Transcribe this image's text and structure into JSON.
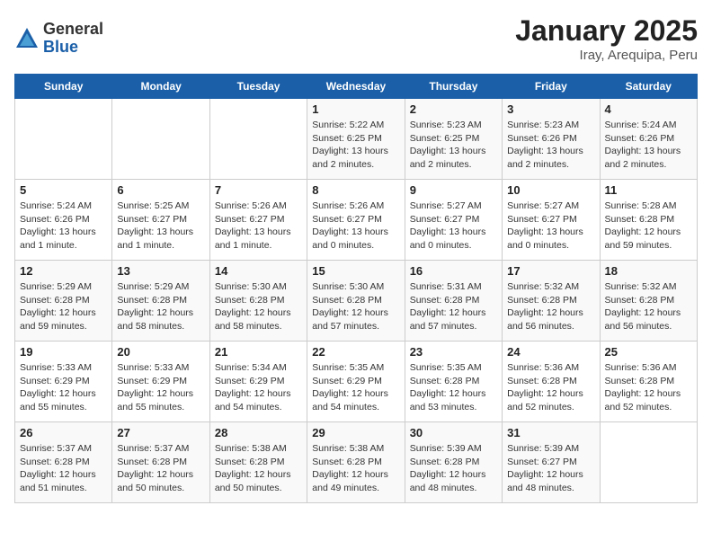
{
  "header": {
    "logo_general": "General",
    "logo_blue": "Blue",
    "title": "January 2025",
    "location": "Iray, Arequipa, Peru"
  },
  "days_of_week": [
    "Sunday",
    "Monday",
    "Tuesday",
    "Wednesday",
    "Thursday",
    "Friday",
    "Saturday"
  ],
  "weeks": [
    [
      {
        "day": "",
        "info": ""
      },
      {
        "day": "",
        "info": ""
      },
      {
        "day": "",
        "info": ""
      },
      {
        "day": "1",
        "info": "Sunrise: 5:22 AM\nSunset: 6:25 PM\nDaylight: 13 hours and 2 minutes."
      },
      {
        "day": "2",
        "info": "Sunrise: 5:23 AM\nSunset: 6:25 PM\nDaylight: 13 hours and 2 minutes."
      },
      {
        "day": "3",
        "info": "Sunrise: 5:23 AM\nSunset: 6:26 PM\nDaylight: 13 hours and 2 minutes."
      },
      {
        "day": "4",
        "info": "Sunrise: 5:24 AM\nSunset: 6:26 PM\nDaylight: 13 hours and 2 minutes."
      }
    ],
    [
      {
        "day": "5",
        "info": "Sunrise: 5:24 AM\nSunset: 6:26 PM\nDaylight: 13 hours and 1 minute."
      },
      {
        "day": "6",
        "info": "Sunrise: 5:25 AM\nSunset: 6:27 PM\nDaylight: 13 hours and 1 minute."
      },
      {
        "day": "7",
        "info": "Sunrise: 5:26 AM\nSunset: 6:27 PM\nDaylight: 13 hours and 1 minute."
      },
      {
        "day": "8",
        "info": "Sunrise: 5:26 AM\nSunset: 6:27 PM\nDaylight: 13 hours and 0 minutes."
      },
      {
        "day": "9",
        "info": "Sunrise: 5:27 AM\nSunset: 6:27 PM\nDaylight: 13 hours and 0 minutes."
      },
      {
        "day": "10",
        "info": "Sunrise: 5:27 AM\nSunset: 6:27 PM\nDaylight: 13 hours and 0 minutes."
      },
      {
        "day": "11",
        "info": "Sunrise: 5:28 AM\nSunset: 6:28 PM\nDaylight: 12 hours and 59 minutes."
      }
    ],
    [
      {
        "day": "12",
        "info": "Sunrise: 5:29 AM\nSunset: 6:28 PM\nDaylight: 12 hours and 59 minutes."
      },
      {
        "day": "13",
        "info": "Sunrise: 5:29 AM\nSunset: 6:28 PM\nDaylight: 12 hours and 58 minutes."
      },
      {
        "day": "14",
        "info": "Sunrise: 5:30 AM\nSunset: 6:28 PM\nDaylight: 12 hours and 58 minutes."
      },
      {
        "day": "15",
        "info": "Sunrise: 5:30 AM\nSunset: 6:28 PM\nDaylight: 12 hours and 57 minutes."
      },
      {
        "day": "16",
        "info": "Sunrise: 5:31 AM\nSunset: 6:28 PM\nDaylight: 12 hours and 57 minutes."
      },
      {
        "day": "17",
        "info": "Sunrise: 5:32 AM\nSunset: 6:28 PM\nDaylight: 12 hours and 56 minutes."
      },
      {
        "day": "18",
        "info": "Sunrise: 5:32 AM\nSunset: 6:28 PM\nDaylight: 12 hours and 56 minutes."
      }
    ],
    [
      {
        "day": "19",
        "info": "Sunrise: 5:33 AM\nSunset: 6:29 PM\nDaylight: 12 hours and 55 minutes."
      },
      {
        "day": "20",
        "info": "Sunrise: 5:33 AM\nSunset: 6:29 PM\nDaylight: 12 hours and 55 minutes."
      },
      {
        "day": "21",
        "info": "Sunrise: 5:34 AM\nSunset: 6:29 PM\nDaylight: 12 hours and 54 minutes."
      },
      {
        "day": "22",
        "info": "Sunrise: 5:35 AM\nSunset: 6:29 PM\nDaylight: 12 hours and 54 minutes."
      },
      {
        "day": "23",
        "info": "Sunrise: 5:35 AM\nSunset: 6:28 PM\nDaylight: 12 hours and 53 minutes."
      },
      {
        "day": "24",
        "info": "Sunrise: 5:36 AM\nSunset: 6:28 PM\nDaylight: 12 hours and 52 minutes."
      },
      {
        "day": "25",
        "info": "Sunrise: 5:36 AM\nSunset: 6:28 PM\nDaylight: 12 hours and 52 minutes."
      }
    ],
    [
      {
        "day": "26",
        "info": "Sunrise: 5:37 AM\nSunset: 6:28 PM\nDaylight: 12 hours and 51 minutes."
      },
      {
        "day": "27",
        "info": "Sunrise: 5:37 AM\nSunset: 6:28 PM\nDaylight: 12 hours and 50 minutes."
      },
      {
        "day": "28",
        "info": "Sunrise: 5:38 AM\nSunset: 6:28 PM\nDaylight: 12 hours and 50 minutes."
      },
      {
        "day": "29",
        "info": "Sunrise: 5:38 AM\nSunset: 6:28 PM\nDaylight: 12 hours and 49 minutes."
      },
      {
        "day": "30",
        "info": "Sunrise: 5:39 AM\nSunset: 6:28 PM\nDaylight: 12 hours and 48 minutes."
      },
      {
        "day": "31",
        "info": "Sunrise: 5:39 AM\nSunset: 6:27 PM\nDaylight: 12 hours and 48 minutes."
      },
      {
        "day": "",
        "info": ""
      }
    ]
  ]
}
